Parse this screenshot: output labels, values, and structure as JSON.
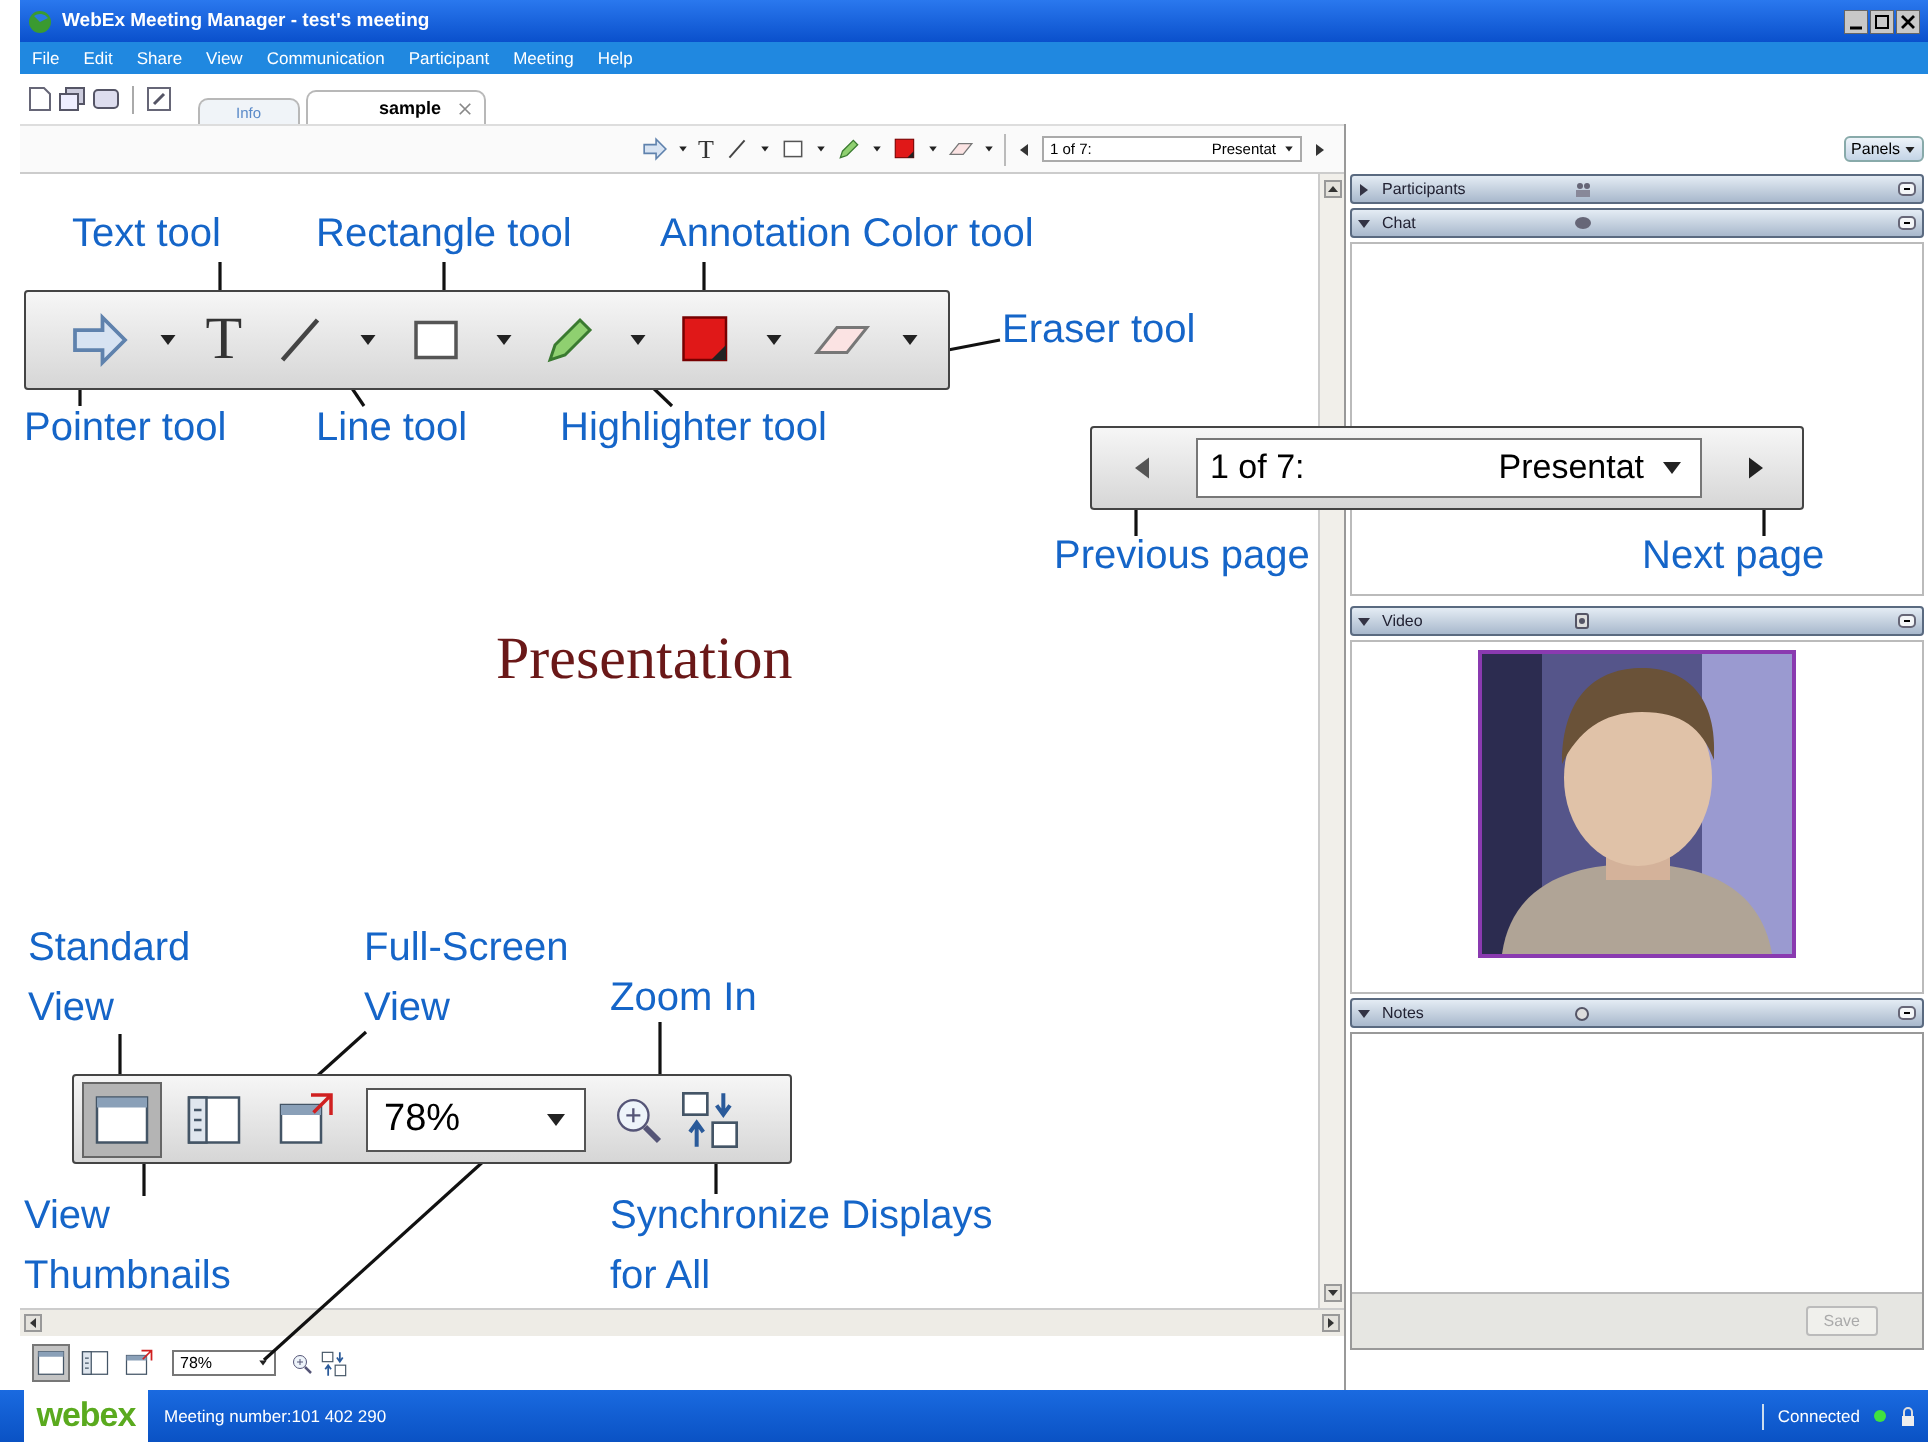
{
  "window": {
    "title": "WebEx Meeting Manager - test's meeting"
  },
  "menu": [
    "File",
    "Edit",
    "Share",
    "View",
    "Communication",
    "Participant",
    "Meeting",
    "Help"
  ],
  "tabs": [
    {
      "label": "Info",
      "selected": false
    },
    {
      "label": "sample",
      "selected": true
    }
  ],
  "annotation_toolbar": {
    "tools": [
      {
        "kind": "pointer",
        "dropdown": true
      },
      {
        "kind": "text",
        "glyph": "T",
        "dropdown": false
      },
      {
        "kind": "line",
        "dropdown": true
      },
      {
        "kind": "rectangle",
        "dropdown": true
      },
      {
        "kind": "highlighter",
        "dropdown": true
      },
      {
        "kind": "color",
        "dropdown": true
      },
      {
        "kind": "eraser",
        "dropdown": true
      }
    ],
    "page": "1 of 7:",
    "document": "Presentat"
  },
  "panels_button": "Panels",
  "slide": {
    "title": "Presentation"
  },
  "callouts": [
    "Text tool",
    "Rectangle tool",
    "Annotation Color tool",
    "Eraser tool",
    "Pointer tool",
    "Line tool",
    "Highlighter tool",
    "Previous page",
    "Next page",
    "Standard View",
    "Full-Screen View",
    "Zoom In",
    "View Thumbnails",
    "Synchronize Displays for All"
  ],
  "enlarged_annotation_toolbar": {
    "tools": [
      {
        "kind": "pointer",
        "dropdown": true
      },
      {
        "kind": "text",
        "glyph": "T",
        "dropdown": false
      },
      {
        "kind": "line",
        "dropdown": true
      },
      {
        "kind": "rectangle",
        "dropdown": true
      },
      {
        "kind": "highlighter",
        "dropdown": true
      },
      {
        "kind": "color",
        "dropdown": true
      },
      {
        "kind": "eraser",
        "dropdown": true
      }
    ]
  },
  "enlarged_page_navigation": {
    "page": "1 of 7:",
    "document": "Presentat"
  },
  "enlarged_view_toolbar": {
    "modes": [
      {
        "kind": "standard",
        "selected": true
      },
      {
        "kind": "thumbnails",
        "selected": false
      },
      {
        "kind": "fullscreen",
        "selected": false
      }
    ],
    "zoom": "78%"
  },
  "side_panels": [
    {
      "title": "Participants",
      "kind": "participants",
      "expanded": false
    },
    {
      "title": "Chat",
      "kind": "chat",
      "expanded": true
    },
    {
      "title": "Video",
      "kind": "video",
      "expanded": true
    },
    {
      "title": "Notes",
      "kind": "notes",
      "expanded": true
    }
  ],
  "save_button": {
    "label": "Save",
    "disabled": true
  },
  "view_toolbar": {
    "modes": [
      {
        "kind": "standard",
        "selected": true
      },
      {
        "kind": "thumbnails",
        "selected": false
      },
      {
        "kind": "fullscreen",
        "selected": false
      }
    ],
    "zoom": "78%"
  },
  "status_bar": {
    "logo": "webex",
    "meeting_number": "Meeting number:101 402 290",
    "connection": "Connected"
  }
}
